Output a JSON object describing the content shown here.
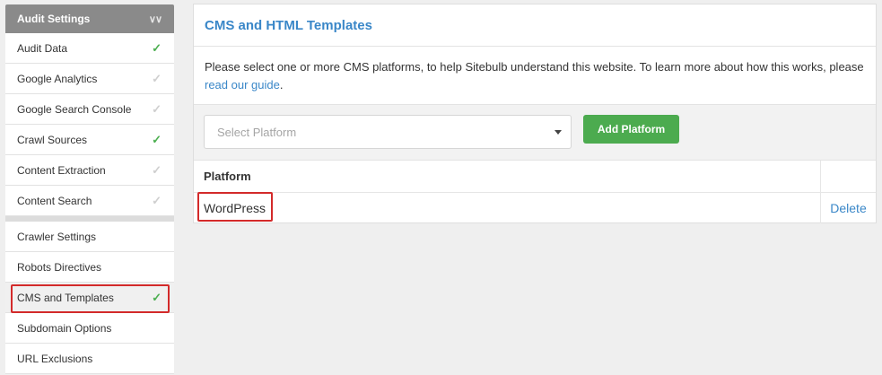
{
  "sidebar": {
    "header": "Audit Settings",
    "header_icon": "double-chevron-down-icon",
    "group1": [
      {
        "label": "Audit Data",
        "checked": true
      },
      {
        "label": "Google Analytics",
        "checked": false
      },
      {
        "label": "Google Search Console",
        "checked": false
      },
      {
        "label": "Crawl Sources",
        "checked": true
      },
      {
        "label": "Content Extraction",
        "checked": false
      },
      {
        "label": "Content Search",
        "checked": false
      }
    ],
    "group2": [
      {
        "label": "Crawler Settings"
      },
      {
        "label": "Robots Directives"
      },
      {
        "label": "CMS and Templates",
        "checked": true,
        "active": true
      },
      {
        "label": "Subdomain Options"
      },
      {
        "label": "URL Exclusions"
      }
    ]
  },
  "panel": {
    "title": "CMS and HTML Templates",
    "desc_text": "Please select one or more CMS platforms, to help Sitebulb understand this website. To learn more about how this works, please ",
    "desc_link": "read our guide",
    "desc_end": ".",
    "select_placeholder": "Select Platform",
    "add_button": "Add Platform",
    "table_header": "Platform",
    "rows": [
      {
        "platform": "WordPress",
        "action": "Delete"
      }
    ]
  },
  "colors": {
    "accent": "#3a87c8",
    "button": "#4cab4f",
    "check": "#4caf50",
    "highlight": "#d32a2a"
  }
}
